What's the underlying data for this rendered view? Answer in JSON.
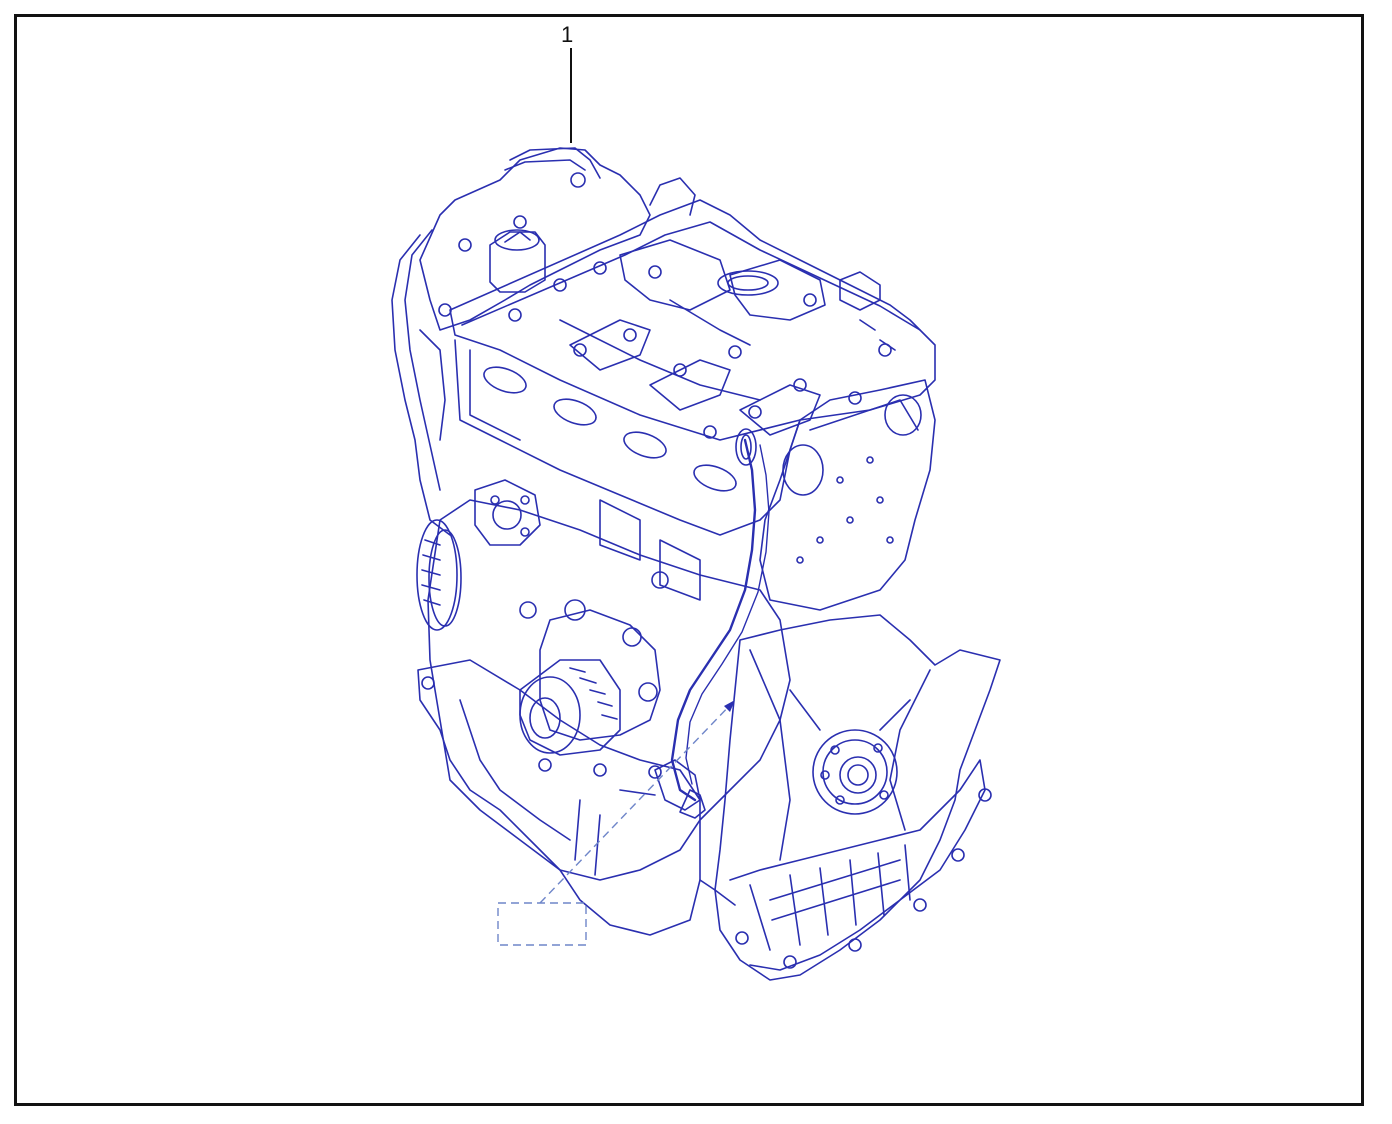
{
  "diagram": {
    "callouts": [
      {
        "label": "1"
      }
    ],
    "colors": {
      "line_art": "#2a2fb0",
      "line_art_light": "#5a63d6",
      "frame": "#111111",
      "leader": "#111111",
      "dashed_box": "#6f86c9"
    },
    "icon": "engine-assembly-line-drawing"
  }
}
